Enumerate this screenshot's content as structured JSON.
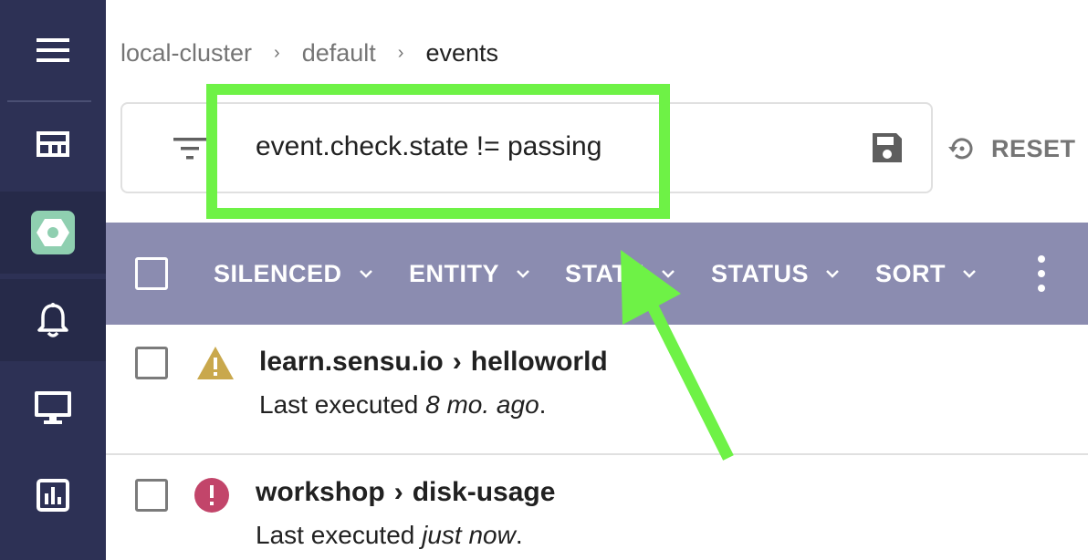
{
  "sidebar": {
    "items": [
      {
        "icon": "menu-icon"
      },
      {
        "icon": "dashboard-icon"
      },
      {
        "icon": "cluster-hexagon-icon"
      },
      {
        "icon": "bell-icon"
      },
      {
        "icon": "monitor-icon"
      },
      {
        "icon": "bar-chart-icon"
      }
    ],
    "colors": {
      "background": "#2d3155",
      "active": "#262a49",
      "badge": "#8fcfb0"
    }
  },
  "breadcrumb": {
    "items": [
      "local-cluster",
      "default",
      "events"
    ],
    "separator": "›"
  },
  "search": {
    "query": "event.check.state != passing",
    "filter_icon": "filter-icon",
    "save_icon": "save-icon"
  },
  "reset": {
    "label": "RESET",
    "icon": "history-icon"
  },
  "toolbar": {
    "background": "#8b8cb0",
    "filters": [
      {
        "label": "SILENCED"
      },
      {
        "label": "ENTITY"
      },
      {
        "label": "STATE"
      },
      {
        "label": "STATUS"
      },
      {
        "label": "SORT"
      }
    ],
    "menu_icon": "more-vert-icon"
  },
  "events": [
    {
      "status": "warning",
      "status_color": "#c9a84c",
      "entity": "learn.sensu.io",
      "check": "helloworld",
      "arrow": "›",
      "executed_prefix": "Last executed ",
      "executed_when": "8 mo. ago",
      "executed_suffix": "."
    },
    {
      "status": "critical",
      "status_color": "#c2456a",
      "entity": "workshop",
      "check": "disk-usage",
      "arrow": "›",
      "executed_prefix": "Last executed ",
      "executed_when": "just now",
      "executed_suffix": "."
    }
  ],
  "annotation": {
    "color": "#6ef246"
  }
}
